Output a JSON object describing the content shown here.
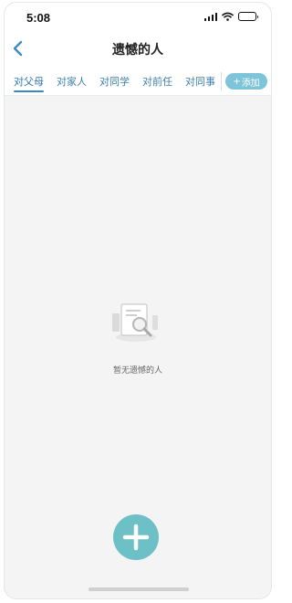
{
  "status_bar": {
    "time": "5:08",
    "icons": [
      "signal-icon",
      "wifi-icon",
      "battery-icon"
    ]
  },
  "nav": {
    "back_icon": "chevron-left-icon",
    "title": "遗憾的人"
  },
  "tabs": [
    {
      "label": "对父母",
      "active": true
    },
    {
      "label": "对家人",
      "active": false
    },
    {
      "label": "对同学",
      "active": false
    },
    {
      "label": "对前任",
      "active": false
    },
    {
      "label": "对同事",
      "active": false
    }
  ],
  "add_tab": {
    "label": "添加",
    "icon": "plus-icon"
  },
  "empty_state": {
    "icon": "document-search-icon",
    "text": "暂无遗憾的人"
  },
  "fab": {
    "icon": "plus-icon"
  },
  "colors": {
    "accent": "#3b8bc0",
    "tab_text": "#3f7fa8",
    "add_button_bg": "#7ec4d8",
    "fab_bg": "#6cc0c6",
    "page_bg": "#f4f4f4"
  }
}
